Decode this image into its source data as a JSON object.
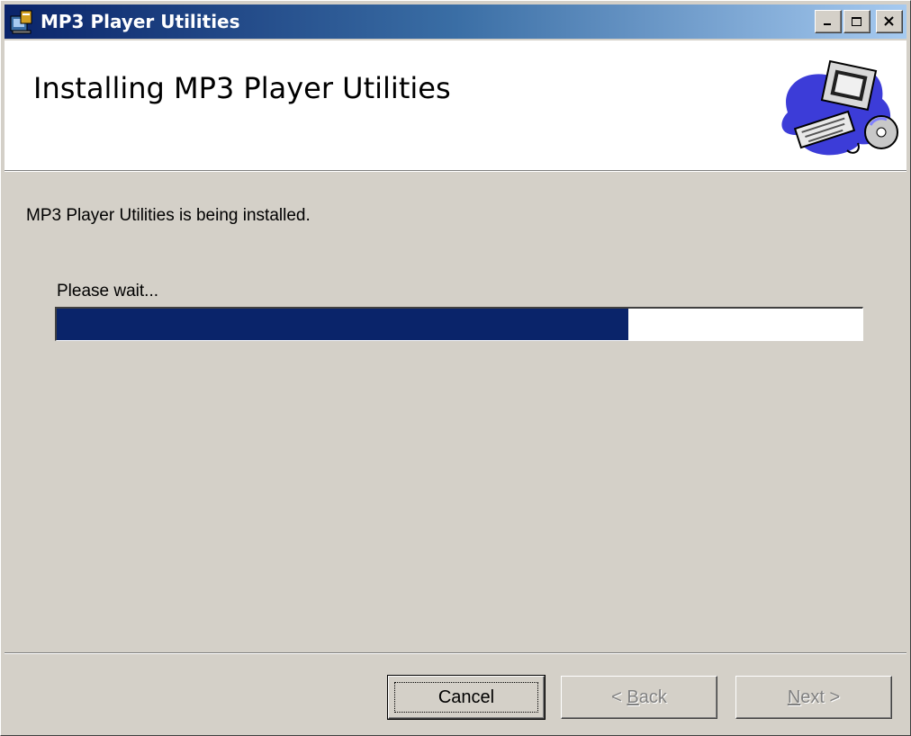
{
  "window": {
    "title": "MP3 Player Utilities",
    "icon": "installer-icon",
    "caption_buttons": [
      "minimize-icon",
      "maximize-icon",
      "close-icon"
    ]
  },
  "header": {
    "title": "Installing MP3 Player Utilities",
    "graphic": "computer-cd-illustration"
  },
  "main": {
    "status": "MP3 Player Utilities is being installed.",
    "wait_label": "Please wait...",
    "progress_fraction": 0.71,
    "progress_color": "#0a246a"
  },
  "buttons": {
    "cancel": "Cancel",
    "back_prefix": "< ",
    "back_accel": "B",
    "back_rest": "ack",
    "next_accel": "N",
    "next_rest": "ext >"
  }
}
